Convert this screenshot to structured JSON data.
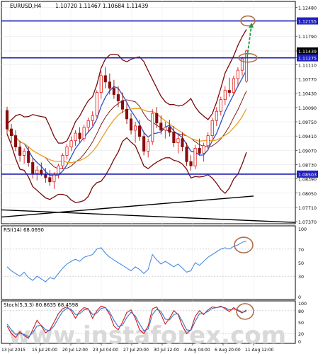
{
  "header": {
    "symbol": "EURUSD,H4",
    "ohlc": "1.10720 1.11467 1.10684 1.11439"
  },
  "chart_data": [
    {
      "type": "candlestick",
      "name": "EURUSD,H4",
      "y_ticks": [
        1.1248,
        1.12155,
        1.1179,
        1.11439,
        1.11275,
        1.1111,
        1.1077,
        1.1043,
        1.1009,
        1.0975,
        1.0941,
        1.0907,
        1.0873,
        1.08503,
        1.0839,
        1.0805,
        1.0771,
        1.0737
      ],
      "ylim": [
        1.0732,
        1.1262
      ],
      "highlighted_levels": [
        1.12155,
        1.11439,
        1.11275,
        1.08503
      ],
      "candles": [
        [
          1.1002,
          1.1011,
          1.0945,
          1.0958
        ],
        [
          1.0958,
          1.097,
          1.0925,
          1.0942
        ],
        [
          1.0942,
          1.0955,
          1.0905,
          1.0915
        ],
        [
          1.0915,
          1.093,
          1.088,
          1.0895
        ],
        [
          1.0895,
          1.0912,
          1.0875,
          1.0905
        ],
        [
          1.0905,
          1.0915,
          1.0868,
          1.0878
        ],
        [
          1.0878,
          1.0888,
          1.084,
          1.0852
        ],
        [
          1.0852,
          1.087,
          1.0835,
          1.086
        ],
        [
          1.086,
          1.0878,
          1.0845,
          1.085
        ],
        [
          1.085,
          1.0865,
          1.083,
          1.0842
        ],
        [
          1.0842,
          1.086,
          1.0822,
          1.0832
        ],
        [
          1.0832,
          1.0855,
          1.0815,
          1.0848
        ],
        [
          1.0848,
          1.0875,
          1.084,
          1.087
        ],
        [
          1.087,
          1.09,
          1.0862,
          1.0895
        ],
        [
          1.0895,
          1.0922,
          1.0885,
          1.0915
        ],
        [
          1.0915,
          1.094,
          1.0905,
          1.093
        ],
        [
          1.093,
          1.0955,
          1.0918,
          1.0948
        ],
        [
          1.0948,
          1.0962,
          1.0925,
          1.0935
        ],
        [
          1.0935,
          1.0968,
          1.0928,
          1.0962
        ],
        [
          1.0962,
          1.0985,
          1.095,
          1.0978
        ],
        [
          1.0978,
          1.1,
          1.0965,
          1.099
        ],
        [
          1.099,
          1.105,
          1.0985,
          1.1045
        ],
        [
          1.1045,
          1.1095,
          1.103,
          1.1085
        ],
        [
          1.1085,
          1.1105,
          1.1055,
          1.107
        ],
        [
          1.107,
          1.109,
          1.104,
          1.1055
        ],
        [
          1.1055,
          1.1075,
          1.103,
          1.104
        ],
        [
          1.104,
          1.106,
          1.101,
          1.1025
        ],
        [
          1.1025,
          1.1045,
          1.0995,
          1.1005
        ],
        [
          1.1005,
          1.102,
          1.097,
          1.0982
        ],
        [
          1.0982,
          1.0995,
          1.0945,
          1.0955
        ],
        [
          1.0955,
          1.0975,
          1.0925,
          1.0965
        ],
        [
          1.0965,
          1.098,
          1.093,
          1.094
        ],
        [
          1.094,
          1.095,
          1.0895,
          1.0905
        ],
        [
          1.0905,
          1.0935,
          1.089,
          1.0928
        ],
        [
          1.0928,
          1.1005,
          1.092,
          1.0995
        ],
        [
          1.0995,
          1.101,
          1.096,
          1.0972
        ],
        [
          1.0972,
          1.099,
          1.0945,
          1.0955
        ],
        [
          1.0955,
          1.0975,
          1.0935,
          1.0962
        ],
        [
          1.0962,
          1.098,
          1.094,
          1.095
        ],
        [
          1.095,
          1.0965,
          1.0915,
          1.0925
        ],
        [
          1.0925,
          1.0945,
          1.09,
          1.0935
        ],
        [
          1.0935,
          1.095,
          1.0905,
          1.0915
        ],
        [
          1.0915,
          1.0925,
          1.087,
          1.088
        ],
        [
          1.088,
          1.0895,
          1.0858,
          1.087
        ],
        [
          1.087,
          1.092,
          1.0862,
          1.0912
        ],
        [
          1.0912,
          1.0935,
          1.0895,
          1.09
        ],
        [
          1.09,
          1.0925,
          1.088,
          1.0918
        ],
        [
          1.0918,
          1.095,
          1.091,
          1.0942
        ],
        [
          1.0942,
          1.0985,
          1.0935,
          1.0978
        ],
        [
          1.0978,
          1.101,
          1.0965,
          1.1
        ],
        [
          1.1,
          1.1035,
          1.099,
          1.1028
        ],
        [
          1.1028,
          1.106,
          1.1015,
          1.105
        ],
        [
          1.105,
          1.108,
          1.1035,
          1.1045
        ],
        [
          1.1045,
          1.1085,
          1.1038,
          1.1078
        ],
        [
          1.1078,
          1.1105,
          1.106,
          1.1098
        ],
        [
          1.1098,
          1.113,
          1.1085,
          1.1125
        ],
        [
          1.1072,
          1.1147,
          1.1068,
          1.1144
        ]
      ],
      "indicators": [
        {
          "type": "moving_average",
          "color": "#3050c8"
        },
        {
          "type": "moving_average",
          "color": "#e8a020"
        },
        {
          "type": "bollinger_bands",
          "color": "#7a0a0a"
        },
        {
          "type": "trendline",
          "color": "#000000"
        }
      ],
      "annotations": [
        {
          "type": "circle",
          "at": 1.12155,
          "color": "#b0704a"
        },
        {
          "type": "circle",
          "at": 1.11275,
          "color": "#b0704a"
        },
        {
          "type": "arrow",
          "from": 1.113,
          "to": 1.1205,
          "color": "#1a9a3a"
        }
      ]
    },
    {
      "type": "line",
      "name": "RSI(14) 68.0690",
      "y_ticks": [
        100,
        70,
        50,
        30,
        0
      ],
      "ylim": [
        0,
        100
      ],
      "color": "#4a8ae0",
      "values": [
        44,
        38,
        34,
        30,
        36,
        28,
        24,
        30,
        26,
        22,
        28,
        26,
        34,
        42,
        48,
        52,
        55,
        52,
        58,
        60,
        62,
        70,
        72,
        64,
        58,
        54,
        50,
        46,
        42,
        38,
        44,
        40,
        34,
        40,
        62,
        54,
        48,
        52,
        48,
        44,
        48,
        42,
        36,
        38,
        50,
        46,
        52,
        58,
        62,
        66,
        70,
        72,
        70,
        74,
        76,
        80,
        82
      ]
    },
    {
      "type": "line",
      "name": "Stoch(5,3,3) 80.8635 68.4598",
      "y_ticks": [
        100,
        80,
        50,
        20,
        0
      ],
      "ylim": [
        0,
        100
      ],
      "series": [
        {
          "color": "#cc1a1a",
          "values": [
            40,
            20,
            10,
            25,
            15,
            8,
            30,
            55,
            40,
            22,
            30,
            50,
            72,
            85,
            90,
            80,
            60,
            78,
            88,
            85,
            60,
            80,
            92,
            88,
            70,
            40,
            30,
            50,
            75,
            82,
            60,
            30,
            20,
            40,
            85,
            90,
            70,
            45,
            60,
            80,
            70,
            40,
            20,
            30,
            65,
            80,
            70,
            82,
            90,
            88,
            92,
            85,
            78,
            88,
            80,
            74,
            82
          ]
        },
        {
          "color": "#3a70d0",
          "values": [
            45,
            30,
            18,
            20,
            18,
            12,
            22,
            40,
            42,
            30,
            28,
            40,
            60,
            78,
            86,
            84,
            70,
            72,
            82,
            84,
            70,
            74,
            86,
            88,
            76,
            55,
            38,
            42,
            62,
            76,
            66,
            45,
            28,
            32,
            70,
            84,
            78,
            58,
            56,
            70,
            72,
            52,
            30,
            28,
            52,
            72,
            72,
            78,
            86,
            88,
            90,
            88,
            82,
            84,
            82,
            76,
            78
          ]
        }
      ]
    }
  ],
  "x_labels": [
    "13 Jul 2015",
    "15 Jul 20:00",
    "20 Jul 12:00",
    "23 Jul 04:00",
    "27 Jul 20:00",
    "30 Jul 12:00",
    "4 Aug 04:00",
    "6 Aug 20:00",
    "11 Aug 12:00"
  ],
  "watermark": "www.instaforex.com"
}
